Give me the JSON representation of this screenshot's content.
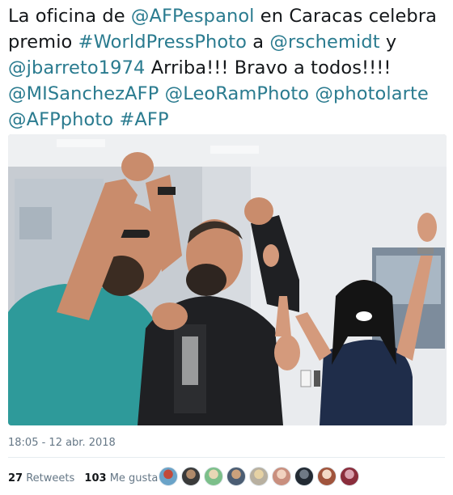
{
  "tweet": {
    "text_parts": [
      {
        "t": "La oficina de ",
        "link": false
      },
      {
        "t": "@AFPespanol",
        "link": true
      },
      {
        "t": " en Caracas celebra premio ",
        "link": false
      },
      {
        "t": "#WorldPressPhoto",
        "link": true
      },
      {
        "t": " a ",
        "link": false
      },
      {
        "t": "@rschemidt",
        "link": true
      },
      {
        "t": " y ",
        "link": false
      },
      {
        "t": "@jbarreto1974",
        "link": true
      },
      {
        "t": " Arriba!!! Bravo a todos!!!! ",
        "link": false
      },
      {
        "t": "@MISanchezAFP",
        "link": true
      },
      {
        "t": " ",
        "link": false
      },
      {
        "t": "@LeoRamPhoto",
        "link": true
      },
      {
        "t": " ",
        "link": false
      },
      {
        "t": "@photolarte",
        "link": true
      },
      {
        "t": " ",
        "link": false
      },
      {
        "t": "@AFPphoto",
        "link": true
      },
      {
        "t": " ",
        "link": false
      },
      {
        "t": "#AFP",
        "link": true
      }
    ],
    "timestamp": "18:05 - 12 abr. 2018"
  },
  "stats": {
    "retweets_count": "27",
    "retweets_label": "Retweets",
    "likes_count": "103",
    "likes_label": "Me gusta"
  },
  "colors": {
    "link": "#2a7b8f",
    "muted": "#657786",
    "text": "#14171a"
  },
  "avatars": [
    {
      "c1": "#6aa3c8",
      "c2": "#c24a3a"
    },
    {
      "c1": "#3a3a3a",
      "c2": "#b08a6a"
    },
    {
      "c1": "#7cbf8a",
      "c2": "#e7d7b5"
    },
    {
      "c1": "#4b5d73",
      "c2": "#caa17c"
    },
    {
      "c1": "#b8b0a0",
      "c2": "#e6d2a4"
    },
    {
      "c1": "#c98f7e",
      "c2": "#f1d3c0"
    },
    {
      "c1": "#222a33",
      "c2": "#6f7a86"
    },
    {
      "c1": "#a0543c",
      "c2": "#f2d9c6"
    },
    {
      "c1": "#8a2d3b",
      "c2": "#d9a1ae"
    }
  ]
}
